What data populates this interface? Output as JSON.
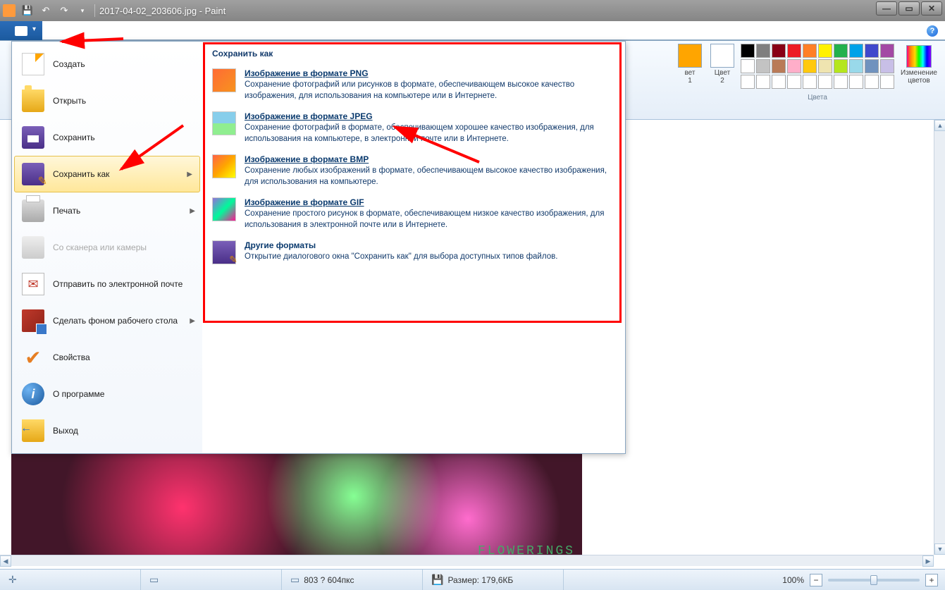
{
  "titlebar": {
    "title": "2017-04-02_203606.jpg - Paint"
  },
  "menu": {
    "items": [
      {
        "label": "Создать",
        "icon": "new"
      },
      {
        "label": "Открыть",
        "icon": "open"
      },
      {
        "label": "Сохранить",
        "icon": "save"
      },
      {
        "label": "Сохранить как",
        "icon": "saveas",
        "hasSubmenu": true,
        "highlighted": true
      },
      {
        "label": "Печать",
        "icon": "print",
        "hasSubmenu": true
      },
      {
        "label": "Со сканера или камеры",
        "icon": "scanner",
        "disabled": true
      },
      {
        "label": "Отправить по электронной почте",
        "icon": "email"
      },
      {
        "label": "Сделать фоном рабочего стола",
        "icon": "wallpaper",
        "hasSubmenu": true
      },
      {
        "label": "Свойства",
        "icon": "props"
      },
      {
        "label": "О программе",
        "icon": "about"
      },
      {
        "label": "Выход",
        "icon": "exit"
      }
    ]
  },
  "submenu": {
    "title": "Сохранить как",
    "items": [
      {
        "title": "Изображение в формате PNG",
        "desc": "Сохранение фотографий или рисунков в формате, обеспечивающем высокое качество изображения, для использования на компьютере или в Интернете.",
        "icon": "png"
      },
      {
        "title": "Изображение в формате JPEG",
        "desc": "Сохранение фотографий в формате, обеспечивающем хорошее качество изображения, для использования на компьютере, в электронной почте или в Интернете.",
        "icon": "jpeg"
      },
      {
        "title": "Изображение в формате BMP",
        "desc": "Сохранение любых изображений в формате, обеспечивающем высокое качество изображения, для использования на компьютере.",
        "icon": "bmp"
      },
      {
        "title": "Изображение в формате GIF",
        "desc": "Сохранение простого рисунок в формате, обеспечивающем низкое качество изображения, для использования в электронной почте или в Интернете.",
        "icon": "gif"
      },
      {
        "title": "Другие форматы",
        "desc": "Открытие диалогового окна \"Сохранить как\" для выбора доступных типов файлов.",
        "icon": "other",
        "nounderline": true
      }
    ]
  },
  "ribbon": {
    "color1_label": "вет\n1",
    "color2_label": "Цвет\n2",
    "edit_colors_label": "Изменение\nцветов",
    "colors_group_label": "Цвета",
    "palette_row1": [
      "#000000",
      "#7f7f7f",
      "#880015",
      "#ed1c24",
      "#ff7f27",
      "#fff200",
      "#22b14c",
      "#00a2e8",
      "#3f48cc",
      "#a349a4"
    ],
    "palette_row2": [
      "#ffffff",
      "#c3c3c3",
      "#b97a57",
      "#ffaec9",
      "#ffc90e",
      "#efe4b0",
      "#b5e61d",
      "#99d9ea",
      "#7092be",
      "#c8bfe7"
    ],
    "palette_row3": [
      "",
      "",
      "",
      "",
      "",
      "",
      "",
      "",
      "",
      ""
    ]
  },
  "statusbar": {
    "dimensions": "803 ? 604пкс",
    "size_label": "Размер: 179,6КБ",
    "zoom": "100%"
  },
  "canvas": {
    "watermark": "FLOWERINGS"
  }
}
